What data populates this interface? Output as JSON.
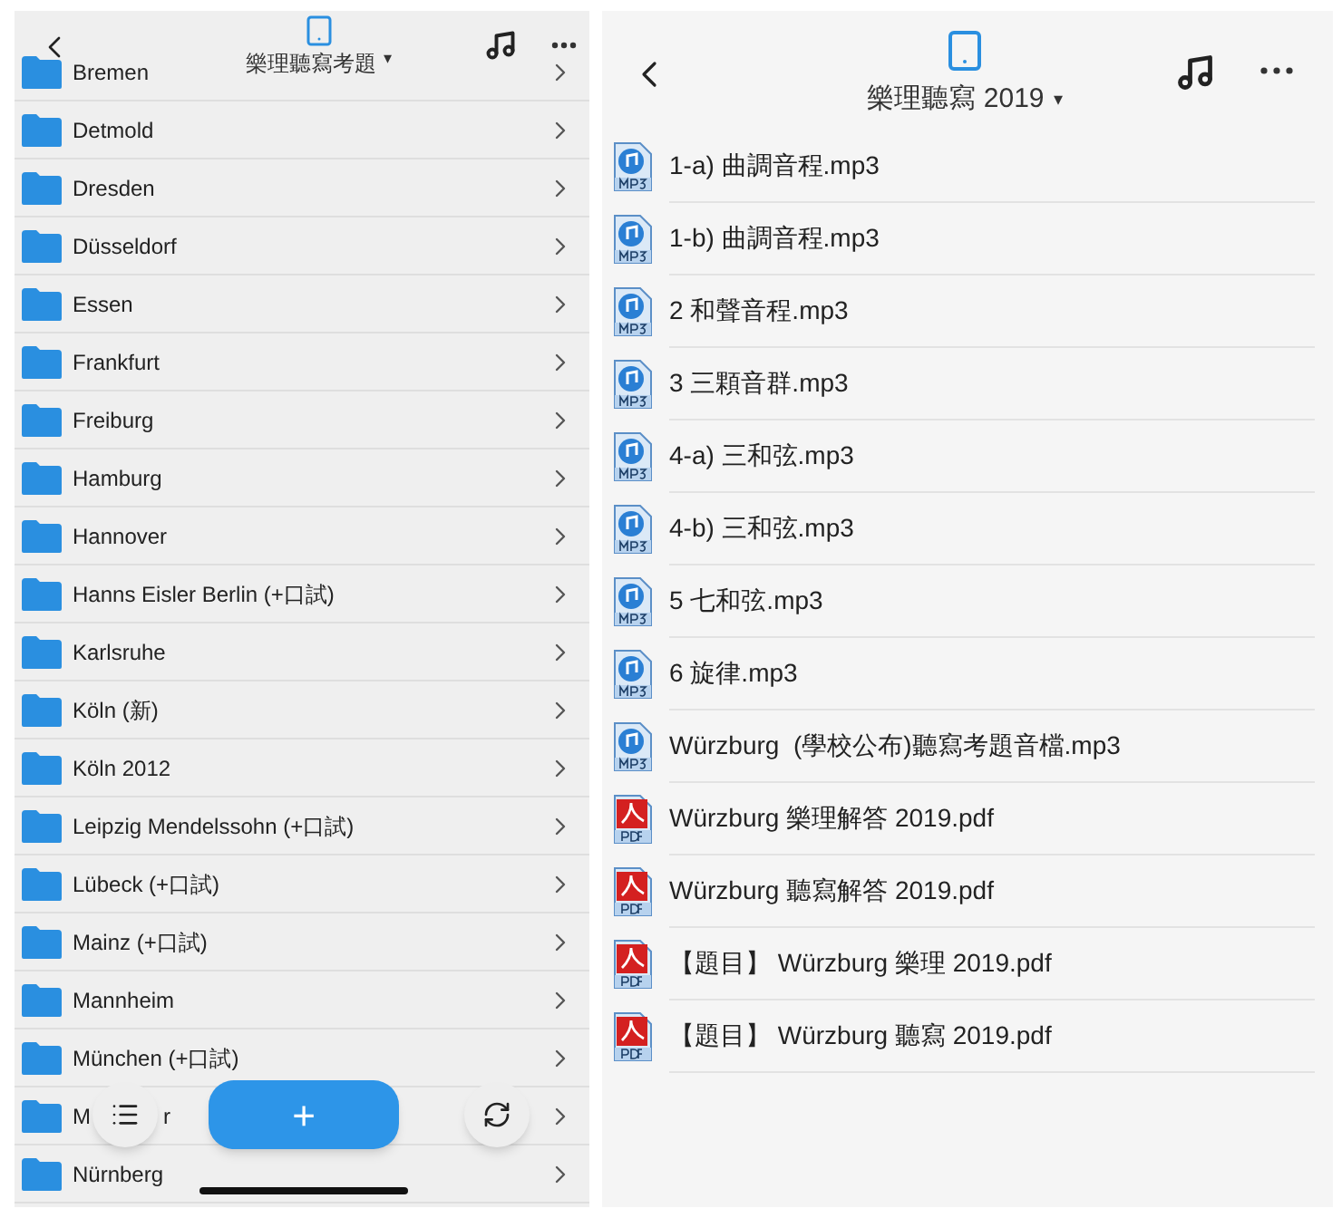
{
  "left": {
    "header": {
      "title": "樂理聽寫考題",
      "caret": "▾"
    },
    "folders": [
      {
        "label": "Bremen"
      },
      {
        "label": "Detmold"
      },
      {
        "label": "Dresden"
      },
      {
        "label": "Düsseldorf"
      },
      {
        "label": "Essen"
      },
      {
        "label": "Frankfurt"
      },
      {
        "label": "Freiburg"
      },
      {
        "label": "Hamburg"
      },
      {
        "label": "Hannover"
      },
      {
        "label": "Hanns Eisler Berlin (+口試)"
      },
      {
        "label": "Karlsruhe"
      },
      {
        "label": "Köln (新)"
      },
      {
        "label": "Köln 2012"
      },
      {
        "label": "Leipzig Mendelssohn (+口試)"
      },
      {
        "label": "Lübeck (+口試)"
      },
      {
        "label": "Mainz (+口試)"
      },
      {
        "label": "Mannheim"
      },
      {
        "label": "München (+口試)"
      },
      {
        "label": "M",
        "label_end": "r"
      },
      {
        "label": "Nürnberg"
      }
    ],
    "add_button": "+"
  },
  "right": {
    "header": {
      "title": "樂理聽寫 2019",
      "caret": "▾"
    },
    "files": [
      {
        "kind": "mp3",
        "name": "1-a) 曲調音程.mp3"
      },
      {
        "kind": "mp3",
        "name": "1-b) 曲調音程.mp3"
      },
      {
        "kind": "mp3",
        "name": "2 和聲音程.mp3"
      },
      {
        "kind": "mp3",
        "name": "3 三顆音群.mp3"
      },
      {
        "kind": "mp3",
        "name": "4-a) 三和弦.mp3"
      },
      {
        "kind": "mp3",
        "name": "4-b) 三和弦.mp3"
      },
      {
        "kind": "mp3",
        "name": "5 七和弦.mp3"
      },
      {
        "kind": "mp3",
        "name": "6 旋律.mp3"
      },
      {
        "kind": "mp3",
        "name": "Würzburg  (學校公布)聽寫考題音檔.mp3"
      },
      {
        "kind": "pdf",
        "name": "Würzburg 樂理解答 2019.pdf"
      },
      {
        "kind": "pdf",
        "name": "Würzburg 聽寫解答 2019.pdf"
      },
      {
        "kind": "pdf",
        "name": "【題目】 Würzburg 樂理 2019.pdf"
      },
      {
        "kind": "pdf",
        "name": "【題目】 Würzburg 聽寫 2019.pdf"
      }
    ]
  }
}
